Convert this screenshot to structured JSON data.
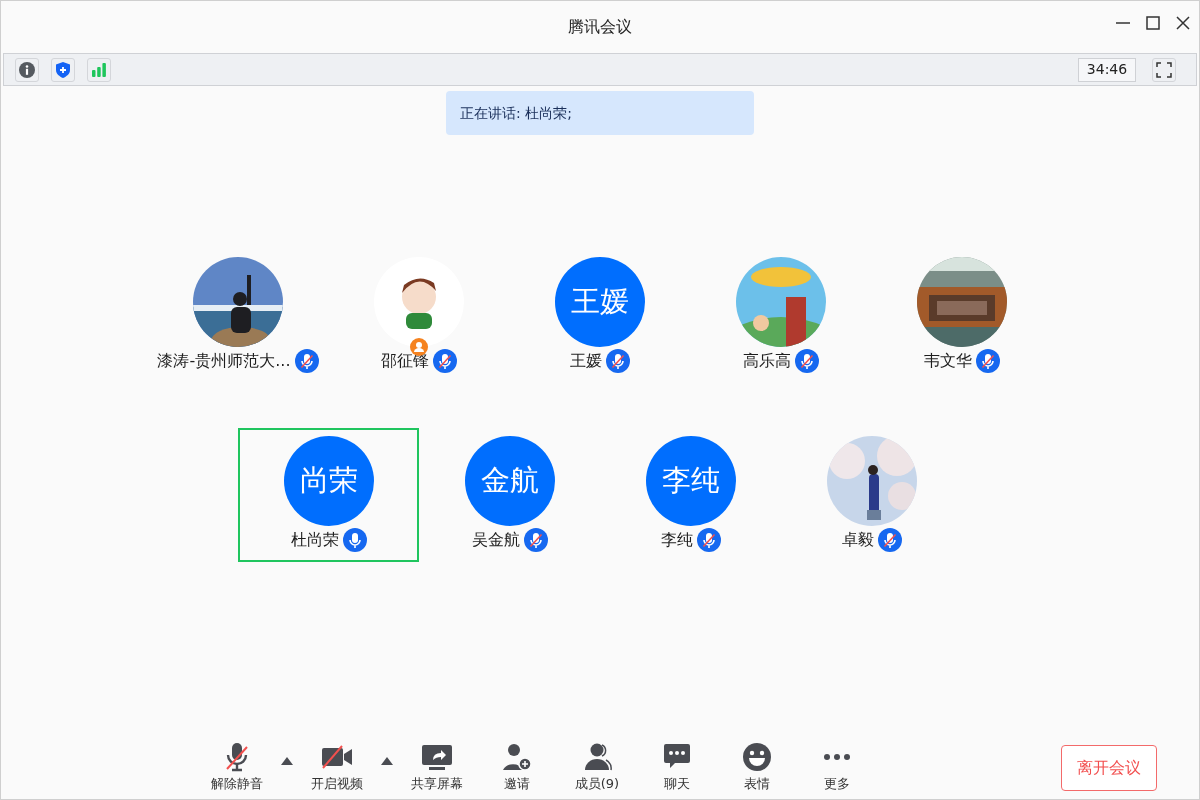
{
  "window": {
    "title": "腾讯会议"
  },
  "status_bar": {
    "timer": "34:46"
  },
  "speaking_banner": "正在讲话: 杜尚荣;",
  "participant_rows": [
    {
      "participants": [
        {
          "name": "漆涛-贵州师范大...",
          "muted": true,
          "host": false,
          "speaking": false
        },
        {
          "name": "邵征锋",
          "muted": true,
          "host": true,
          "speaking": false
        },
        {
          "name": "王媛",
          "avatar": {
            "kind": "initials",
            "text": "王媛"
          },
          "muted": true,
          "host": false,
          "speaking": false
        },
        {
          "name": "高乐高",
          "muted": true,
          "host": false,
          "speaking": false
        },
        {
          "name": "韦文华",
          "muted": true,
          "host": false,
          "speaking": false
        }
      ]
    },
    {
      "participants": [
        {
          "name": "杜尚荣",
          "avatar": {
            "kind": "initials",
            "text": "尚荣"
          },
          "muted": false,
          "host": false,
          "speaking": true
        },
        {
          "name": "吴金航",
          "avatar": {
            "kind": "initials",
            "text": "金航"
          },
          "muted": true,
          "host": false,
          "speaking": false
        },
        {
          "name": "李纯",
          "avatar": {
            "kind": "initials",
            "text": "李纯"
          },
          "muted": true,
          "host": false,
          "speaking": false
        },
        {
          "name": "卓毅",
          "muted": true,
          "host": false,
          "speaking": false
        }
      ]
    }
  ],
  "toolbar": [
    {
      "kind": "mic",
      "label": "解除静音",
      "off": true,
      "menu": true
    },
    {
      "kind": "video",
      "label": "开启视频",
      "off": true,
      "menu": true
    },
    {
      "kind": "share",
      "label": "共享屏幕",
      "menu": false
    },
    {
      "kind": "invite",
      "label": "邀请",
      "menu": false
    },
    {
      "kind": "members",
      "label": "成员(9)",
      "menu": false
    },
    {
      "kind": "chat",
      "label": "聊天",
      "menu": false
    },
    {
      "kind": "emoji",
      "label": "表情",
      "menu": false
    },
    {
      "kind": "more",
      "label": "更多",
      "menu": false
    }
  ],
  "leave_button": "离开会议"
}
